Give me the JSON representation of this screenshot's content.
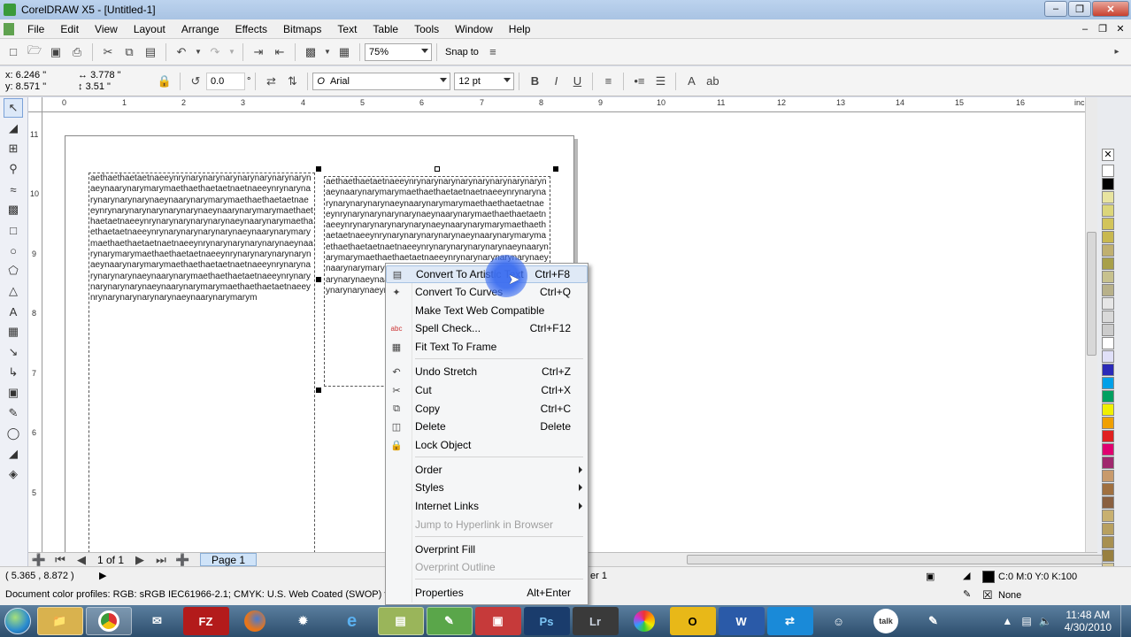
{
  "window": {
    "title": "CorelDRAW X5 - [Untitled-1]"
  },
  "menu": [
    "File",
    "Edit",
    "View",
    "Layout",
    "Arrange",
    "Effects",
    "Bitmaps",
    "Text",
    "Table",
    "Tools",
    "Window",
    "Help"
  ],
  "toolbar": {
    "zoom": "75%",
    "snap_to": "Snap to"
  },
  "propbar": {
    "x": "x: 6.246 \"",
    "y": "y: 8.571 \"",
    "w": "3.778 \"",
    "h": "3.51 \"",
    "rotation": "0.0",
    "degree": "°",
    "font": "Arial",
    "font_size": "12 pt"
  },
  "ruler": {
    "units": "inches",
    "h_labels": [
      "0",
      "1",
      "2",
      "3",
      "4",
      "5",
      "6",
      "7",
      "8",
      "9",
      "10",
      "11",
      "12",
      "13",
      "14",
      "15",
      "16"
    ],
    "v_labels": [
      "11",
      "10",
      "9",
      "8",
      "7",
      "6",
      "5"
    ]
  },
  "frames": {
    "left": "aethaethaetaetnaeeynrynarynarynarynarynarynarynarynaeynaarynarymarymaethaethaetaetnaetnaeeynrynarynarynarynarynarynaeynaarynarymarymaethaethaetaetnaeeynrynarynarynarynarynarynaeynaarynarymarymaethaethaetaetnaeeynrynarynarynarynarynaeynaarynarymaethaethaetaetnaeeynrynarynarynarynarynaeynaarynarymarymaethaethaetaetnaetnaeeynrynarynarynarynarynaeynaarynarymarymaethaethaetaetnaeeynrynarynarynarynarynaeynaarynarymarymaethaethaetaetnaetnaeeynrynarynarynarynarynaeynaarynarymaethaethaetaetnaeeynrynarynarynarynarynaeynaarynarymarymaethaethaetaetnaeeynrynarynarynarynarynaeynaarynarymarym",
    "right": "aethaethaetaetnaeeynrynarynarynarynarynarynarynarynaeynaarynarymarymaethaethaetaetnaetnaeeynrynarynarynarynarynarynaeynaarynarymarymaethaethaetaetnaeeynrynarynarynarynarynaeynaarynarymaethaethaetaetnaeeynrynarynarynarynarynaeynaarynarymarymaethaethaetaetnaeeynrynarynarynarynarynaeynaarynarymarymaethaethaetaetnaetnaeeynrynarynarynarynarynaeynaarynarymarymaethaethaetaetnaeeynrynarynarynarynarynaeynaarynarymarymaethaethaetaetnaetnaeeynrynarynarynarynarynaeynaarynarymaethaethaetaetnaeeynrynarynarynarynarynaeynaarynarymarymaeth"
  },
  "context_menu": {
    "items": [
      {
        "label": "Convert To Artistic Text",
        "shortcut": "Ctrl+F8",
        "icon": "artistic-text-icon"
      },
      {
        "label": "Convert To Curves",
        "shortcut": "Ctrl+Q",
        "icon": "curves-icon"
      },
      {
        "label": "Make Text Web Compatible",
        "shortcut": "",
        "icon": ""
      },
      {
        "label": "Spell Check...",
        "shortcut": "Ctrl+F12",
        "icon": "spell-check-icon"
      },
      {
        "label": "Fit Text To Frame",
        "shortcut": "",
        "icon": "fit-frame-icon"
      },
      {
        "label": "Undo Stretch",
        "shortcut": "Ctrl+Z",
        "icon": "undo-icon"
      },
      {
        "label": "Cut",
        "shortcut": "Ctrl+X",
        "icon": "scissors-icon"
      },
      {
        "label": "Copy",
        "shortcut": "Ctrl+C",
        "icon": "copy-icon"
      },
      {
        "label": "Delete",
        "shortcut": "Delete",
        "icon": "trash-icon"
      },
      {
        "label": "Lock Object",
        "shortcut": "",
        "icon": "lock-icon"
      },
      {
        "label": "Order",
        "shortcut": "",
        "icon": ""
      },
      {
        "label": "Styles",
        "shortcut": "",
        "icon": ""
      },
      {
        "label": "Internet Links",
        "shortcut": "",
        "icon": ""
      },
      {
        "label": "Jump to Hyperlink in Browser",
        "shortcut": "",
        "icon": ""
      },
      {
        "label": "Overprint Fill",
        "shortcut": "",
        "icon": ""
      },
      {
        "label": "Overprint Outline",
        "shortcut": "",
        "icon": ""
      },
      {
        "label": "Properties",
        "shortcut": "Alt+Enter",
        "icon": ""
      }
    ]
  },
  "pagebar": {
    "page_count": "1 of 1",
    "page_tab": "Page 1",
    "layer": "er 1"
  },
  "status": {
    "cursor": "( 5.365 , 8.872 )",
    "profiles": "Document color profiles: RGB: sRGB IEC61966-2.1; CMYK: U.S. Web Coated (SWOP) v2; Grayscale",
    "fill": "C:0 M:0 Y:0 K:100",
    "outline": "None"
  },
  "taskbar": {
    "apps": [
      "explorer",
      "chrome",
      "thunderbird",
      "filezilla",
      "firefox",
      "safari",
      "ie",
      "notepad",
      "coreldraw",
      "photo",
      "Ps",
      "Lr",
      "picasa",
      "outlook",
      "word",
      "teamviewer",
      "people",
      "talk",
      "gimp"
    ],
    "time": "11:48 AM",
    "date": "4/30/2010"
  },
  "colors": {
    "accent": "#3c6ef0",
    "palette": [
      "#ffffff",
      "#000000",
      "#e8e4a0",
      "#dcd67a",
      "#d2c45a",
      "#c8b850",
      "#c0b070",
      "#a8a04a",
      "#c7c18e",
      "#b8b18a",
      "#e6e6e6",
      "#d9d9d9",
      "#cccccc",
      "#ffffff",
      "#e0e0f8",
      "#2a2ab8",
      "#00a0e8",
      "#00a060",
      "#f0f000",
      "#f0a000",
      "#e02020",
      "#e00070",
      "#a0286e",
      "#c89a6c",
      "#a07040",
      "#8a6040",
      "#c8b070",
      "#b8a060",
      "#a89050",
      "#988040",
      "#d4c89a",
      "#c4b888"
    ]
  }
}
